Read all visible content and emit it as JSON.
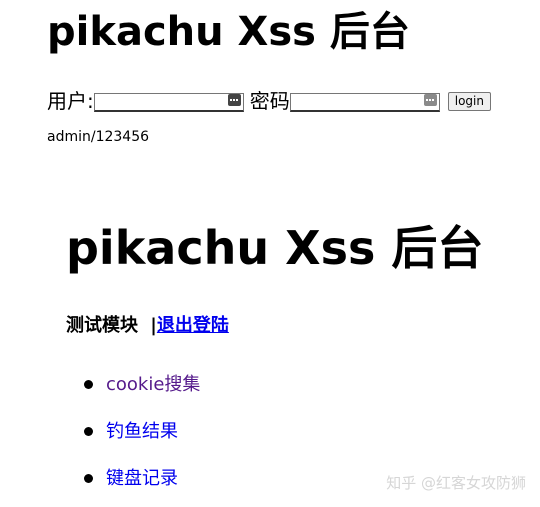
{
  "login": {
    "title": "pikachu Xss 后台",
    "username_label": "用户:",
    "username_value": "",
    "password_label": "密码",
    "password_value": "",
    "login_button": "login",
    "hint": "admin/123456"
  },
  "admin": {
    "title": "pikachu Xss 后台",
    "module_label": "测试模块",
    "separator": "|",
    "logout_link": "退出登陆",
    "menu": [
      {
        "label": "cookie搜集",
        "state": "visited"
      },
      {
        "label": "钓鱼结果",
        "state": "unvisited"
      },
      {
        "label": "键盘记录",
        "state": "unvisited"
      }
    ]
  },
  "watermark": "知乎 @红客女攻防狮",
  "colors": {
    "link": "#0000ee",
    "visited_link": "#551a8b",
    "watermark": "#d6d6d6"
  }
}
